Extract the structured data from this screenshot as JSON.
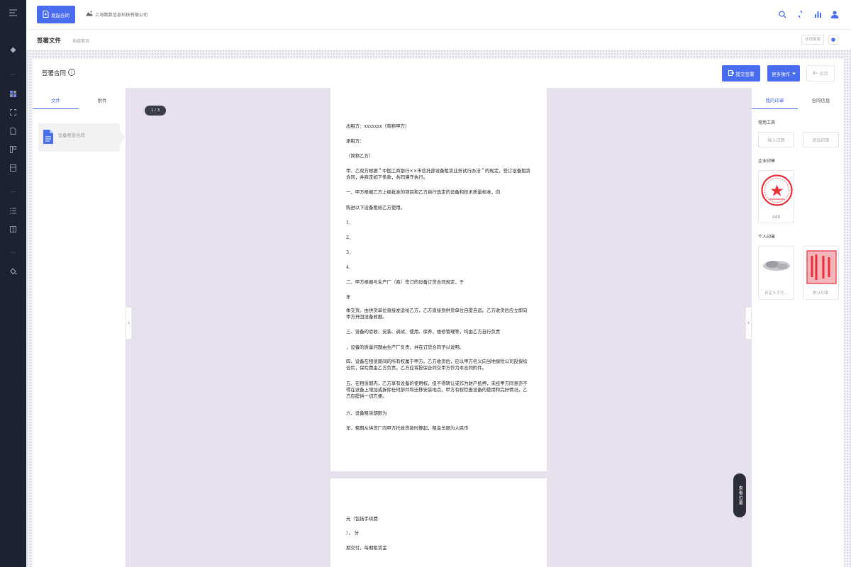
{
  "topbar": {
    "start_contract_label": "发起合同",
    "company_name": "上海数数信息科技有限公司"
  },
  "subnav": {
    "title": "签署文件",
    "breadcrumb": "系统首页",
    "right_tag": "在线客服"
  },
  "header": {
    "title": "签署合同",
    "submit_label": "提交签署",
    "more_label": "更多操作",
    "back_label": "返回"
  },
  "left_panel": {
    "tabs": [
      "文件",
      "附件"
    ],
    "file_name": "设备租赁合同"
  },
  "viewer": {
    "page_indicator": "1 / 3",
    "page1": [
      "出租方：xxxxxxx（简称甲方）",
      "承租方：",
      "（简称乙方）",
      "甲、乙双方根据＂中国工商银行××市信托部设备租赁业务试行办法＂的规定，签订设备租赁合同，并商定如下条款，共同遵守执行。",
      "一、甲方根据乙方上级批准的项目和乙方自行选定的设备和技术质量标准，向",
      "购进以下设备租给乙方使用。",
      "1．",
      "2．",
      "3．",
      "4．",
      "二、甲方根据与生产厂（商）签订的设备订货合同规定，于",
      "年",
      "季交货。由供货单位直接发运给乙方，乙方直接到供货单位自提自运。乙方收货后应立即向甲方开回设备收据。",
      "三、设备的验收、安装、调试、使用、保养、维修管理等，均由乙方自行负责",
      "，设备的质量问题由生产厂负责，并在订货合同予以说明。",
      "四、设备在租赁期间的所有权属于甲方。乙方收货后，应以甲方名义向当地保险公司投保综合险，保险费由乙方负责。乙方应将投保合同交甲方作为本合同附件。",
      "五、在租赁期内，乙方享有设备的使用权，但不得转让或作为财产抵押，未经甲方同意亦不得在设备上增加或拆除任何部件和迁移安装地点。甲方有权检查设备的使用和完好情况，乙方应提供一切方便。",
      "六、设备租赁期限为",
      "年，租期从供货厂向甲方托收货款时算起，租金总额为人民币"
    ],
    "page2": [
      "元（包括手续费",
      "）， 分",
      "期交付，每期租赁金"
    ],
    "float_label": "查看位置"
  },
  "right_panel": {
    "tabs": [
      "我的印章",
      "合同信息"
    ],
    "common_tools_label": "常用工具",
    "tool_buttons": [
      "插入日期",
      "添加印章"
    ],
    "company_seal_label": "企业印章",
    "company_seal_name": "440",
    "personal_seal_label": "个人印章",
    "personal_seals": [
      "自定义手写...",
      "默认印章"
    ]
  },
  "colors": {
    "primary": "#4a6df0",
    "sidebar": "#1d2230",
    "viewer_bg": "#e7e0ee",
    "seal_red": "#e8303a"
  }
}
